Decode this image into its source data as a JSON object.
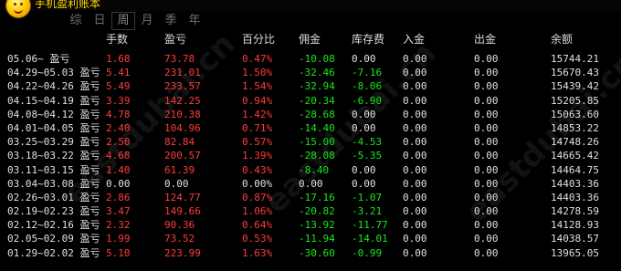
{
  "app": {
    "title": "手机盈利账本"
  },
  "tabs": [
    {
      "label": "综",
      "active": false
    },
    {
      "label": "日",
      "active": false
    },
    {
      "label": "周",
      "active": true
    },
    {
      "label": "月",
      "active": false
    },
    {
      "label": "季",
      "active": false
    },
    {
      "label": "年",
      "active": false
    }
  ],
  "columns": {
    "qty": "手数",
    "pnl": "盈亏",
    "pct": "百分比",
    "commission": "佣金",
    "inventory_fee": "库存费",
    "deposit": "入金",
    "withdraw": "出金",
    "balance": "余额"
  },
  "watermark_text": "eastdubai.cn",
  "colors": {
    "positive": "#ff3b3b",
    "negative": "#19e619",
    "neutral": "#e0e0e0",
    "background": "#000000",
    "title": "#ffd700"
  },
  "rows": [
    {
      "date": "05.06~ 盈亏",
      "qty": "1.68",
      "pnl": "73.78",
      "pct": "0.47%",
      "commission": "-10.08",
      "inventory_fee": "0.00",
      "deposit": "0.00",
      "withdraw": "0.00",
      "balance": "15744.21"
    },
    {
      "date": "04.29~05.03 盈亏",
      "qty": "5.41",
      "pnl": "231.01",
      "pct": "1.50%",
      "commission": "-32.46",
      "inventory_fee": "-7.16",
      "deposit": "0.00",
      "withdraw": "0.00",
      "balance": "15670.43"
    },
    {
      "date": "04.22~04.26 盈亏",
      "qty": "5.49",
      "pnl": "233.57",
      "pct": "1.54%",
      "commission": "-32.94",
      "inventory_fee": "-8.06",
      "deposit": "0.00",
      "withdraw": "0.00",
      "balance": "15439.42"
    },
    {
      "date": "04.15~04.19 盈亏",
      "qty": "3.39",
      "pnl": "142.25",
      "pct": "0.94%",
      "commission": "-20.34",
      "inventory_fee": "-6.90",
      "deposit": "0.00",
      "withdraw": "0.00",
      "balance": "15205.85"
    },
    {
      "date": "04.08~04.12 盈亏",
      "qty": "4.78",
      "pnl": "210.38",
      "pct": "1.42%",
      "commission": "-28.68",
      "inventory_fee": "0.00",
      "deposit": "0.00",
      "withdraw": "0.00",
      "balance": "15063.60"
    },
    {
      "date": "04.01~04.05 盈亏",
      "qty": "2.40",
      "pnl": "104.96",
      "pct": "0.71%",
      "commission": "-14.40",
      "inventory_fee": "0.00",
      "deposit": "0.00",
      "withdraw": "0.00",
      "balance": "14853.22"
    },
    {
      "date": "03.25~03.29 盈亏",
      "qty": "2.50",
      "pnl": "82.84",
      "pct": "0.57%",
      "commission": "-15.00",
      "inventory_fee": "-4.53",
      "deposit": "0.00",
      "withdraw": "0.00",
      "balance": "14748.26"
    },
    {
      "date": "03.18~03.22 盈亏",
      "qty": "4.68",
      "pnl": "200.57",
      "pct": "1.39%",
      "commission": "-28.08",
      "inventory_fee": "-5.35",
      "deposit": "0.00",
      "withdraw": "0.00",
      "balance": "14665.42"
    },
    {
      "date": "03.11~03.15 盈亏",
      "qty": "1.40",
      "pnl": "61.39",
      "pct": "0.43%",
      "commission": "-8.40",
      "inventory_fee": "0.00",
      "deposit": "0.00",
      "withdraw": "0.00",
      "balance": "14464.75"
    },
    {
      "date": "03.04~03.08 盈亏",
      "qty": "0.00",
      "pnl": "0.00",
      "pct": "0.00%",
      "commission": "0.00",
      "inventory_fee": "0.00",
      "deposit": "0.00",
      "withdraw": "0.00",
      "balance": "14403.36"
    },
    {
      "date": "02.26~03.01 盈亏",
      "qty": "2.86",
      "pnl": "124.77",
      "pct": "0.87%",
      "commission": "-17.16",
      "inventory_fee": "-1.07",
      "deposit": "0.00",
      "withdraw": "0.00",
      "balance": "14403.36"
    },
    {
      "date": "02.19~02.23 盈亏",
      "qty": "3.47",
      "pnl": "149.66",
      "pct": "1.06%",
      "commission": "-20.82",
      "inventory_fee": "-3.21",
      "deposit": "0.00",
      "withdraw": "0.00",
      "balance": "14278.59"
    },
    {
      "date": "02.12~02.16 盈亏",
      "qty": "2.32",
      "pnl": "90.36",
      "pct": "0.64%",
      "commission": "-13.92",
      "inventory_fee": "-11.77",
      "deposit": "0.00",
      "withdraw": "0.00",
      "balance": "14128.93"
    },
    {
      "date": "02.05~02.09 盈亏",
      "qty": "1.99",
      "pnl": "73.52",
      "pct": "0.53%",
      "commission": "-11.94",
      "inventory_fee": "-14.01",
      "deposit": "0.00",
      "withdraw": "0.00",
      "balance": "14038.57"
    },
    {
      "date": "01.29~02.02 盈亏",
      "qty": "5.10",
      "pnl": "223.99",
      "pct": "1.63%",
      "commission": "-30.60",
      "inventory_fee": "-0.99",
      "deposit": "0.00",
      "withdraw": "0.00",
      "balance": "13965.05"
    }
  ]
}
